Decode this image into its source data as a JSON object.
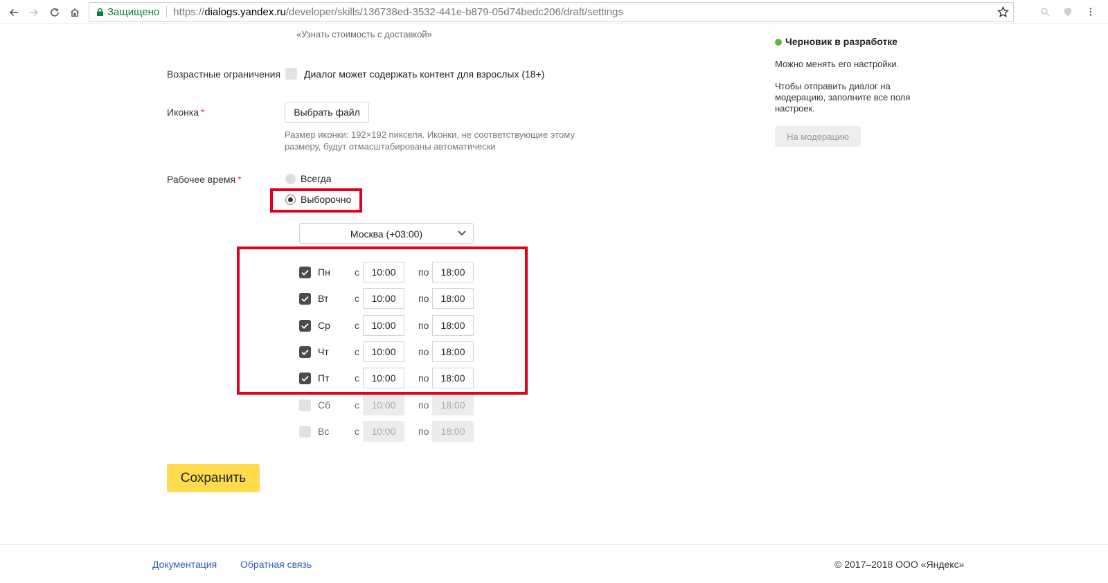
{
  "browser": {
    "secure_label": "Защищено",
    "url_scheme": "https://",
    "url_host": "dialogs.yandex.ru",
    "url_path": "/developer/skills/136738ed-3532-441e-b879-05d74bedc206/draft/settings"
  },
  "form": {
    "example_hint": "«Узнать стоимость с доставкой»",
    "age": {
      "label": "Возрастные ограничения",
      "checkbox_label": "Диалог может содержать контент для взрослых (18+)",
      "checked": false
    },
    "icon": {
      "label": "Иконка",
      "required_mark": "*",
      "button": "Выбрать файл",
      "hint_line1": "Размер иконки: 192×192 пикселя. Иконки, не соответствующие этому",
      "hint_line2": "размеру, будут отмасштабированы автоматически"
    },
    "work_time": {
      "label": "Рабочее время",
      "required_mark": "*",
      "option_always": "Всегда",
      "option_selective": "Выборочно",
      "selected": "Выборочно",
      "timezone": "Москва (+03:00)",
      "from_label": "с",
      "to_label": "по",
      "days": [
        {
          "name": "Пн",
          "checked": true,
          "from": "10:00",
          "to": "18:00"
        },
        {
          "name": "Вт",
          "checked": true,
          "from": "10:00",
          "to": "18:00"
        },
        {
          "name": "Ср",
          "checked": true,
          "from": "10:00",
          "to": "18:00"
        },
        {
          "name": "Чт",
          "checked": true,
          "from": "10:00",
          "to": "18:00"
        },
        {
          "name": "Пт",
          "checked": true,
          "from": "10:00",
          "to": "18:00"
        },
        {
          "name": "Сб",
          "checked": false,
          "from": "10:00",
          "to": "18:00"
        },
        {
          "name": "Вс",
          "checked": false,
          "from": "10:00",
          "to": "18:00"
        }
      ]
    },
    "save_button": "Сохранить"
  },
  "status": {
    "title": "Черновик в разработке",
    "text1": "Можно менять его настройки.",
    "text2_line1": "Чтобы отправить диалог на",
    "text2_line2": "модерацию, заполните все поля",
    "text2_line3": "настроек.",
    "moderation_button": "На модерацию",
    "dot_color": "#5bb836"
  },
  "footer": {
    "docs_link": "Документация",
    "feedback_link": "Обратная связь",
    "copyright": "© 2017–2018 ООО «Яндекс»"
  },
  "colors": {
    "highlight_box": "#e3001b",
    "save_button": "#ffdb4d",
    "link": "#2f5bb7"
  }
}
